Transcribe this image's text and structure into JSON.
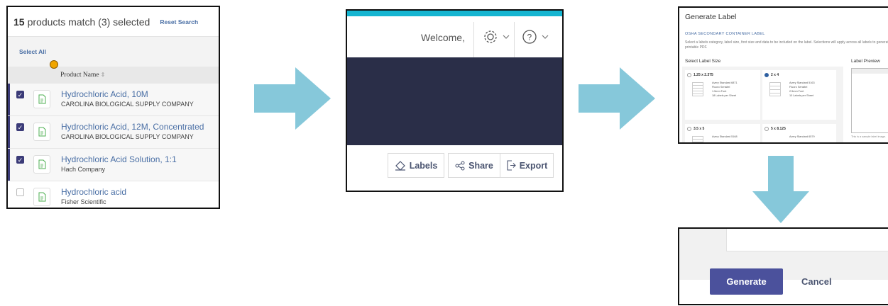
{
  "panel1": {
    "count": "15",
    "match_text": "products match (3) selected",
    "reset": "Reset Search",
    "select_all": "Select All",
    "column_header": "Product Name",
    "rows": [
      {
        "name": "Hydrochloric Acid, 10M",
        "company": "CAROLINA BIOLOGICAL SUPPLY COMPANY",
        "checked": true
      },
      {
        "name": "Hydrochloric Acid, 12M, Concentrated",
        "company": "CAROLINA BIOLOGICAL SUPPLY COMPANY",
        "checked": true
      },
      {
        "name": "Hydrochloric Acid Solution, 1:1",
        "company": "Hach Company",
        "checked": true
      },
      {
        "name": "Hydrochloric acid",
        "company": "Fisher Scientific",
        "checked": false
      }
    ]
  },
  "panel2": {
    "welcome": "Welcome,",
    "labels_btn": "Labels",
    "share_btn": "Share",
    "export_btn": "Export"
  },
  "panel3": {
    "title": "Generate Label",
    "subtitle": "OSHA SECONDARY CONTAINER LABEL",
    "description": "Select a labels category, label size, font size and data to be included on the label. Selections will apply across all labels to generate a printable PDF.",
    "select_size": "Select Label Size",
    "preview_label": "Label Preview",
    "sizes": [
      {
        "size": "1.25 x 2.375",
        "selected": false,
        "items": [
          "Avery Standard 6871",
          "Fluoro Sensitel",
          "1.5mm Font",
          "18 Labels per Sheet"
        ]
      },
      {
        "size": "2 x 4",
        "selected": true,
        "items": [
          "Avery Standard 5163",
          "Fluoro Sensitel",
          "2.5mm Font",
          "10 Labels per Sheet"
        ]
      },
      {
        "size": "3.5 x 5",
        "selected": false,
        "items": [
          "Avery Standard 5168"
        ]
      },
      {
        "size": "5 x 8.125",
        "selected": false,
        "items": [
          "Avery Standard 6579"
        ]
      }
    ],
    "preview_note": "This is a sample label image."
  },
  "panel4": {
    "generate": "Generate",
    "cancel": "Cancel"
  },
  "colors": {
    "accent_blue": "#4a6fa5",
    "navy": "#2a2e48",
    "cyan": "#15b5d1",
    "arrow": "#86c8da",
    "button": "#4b519c"
  }
}
